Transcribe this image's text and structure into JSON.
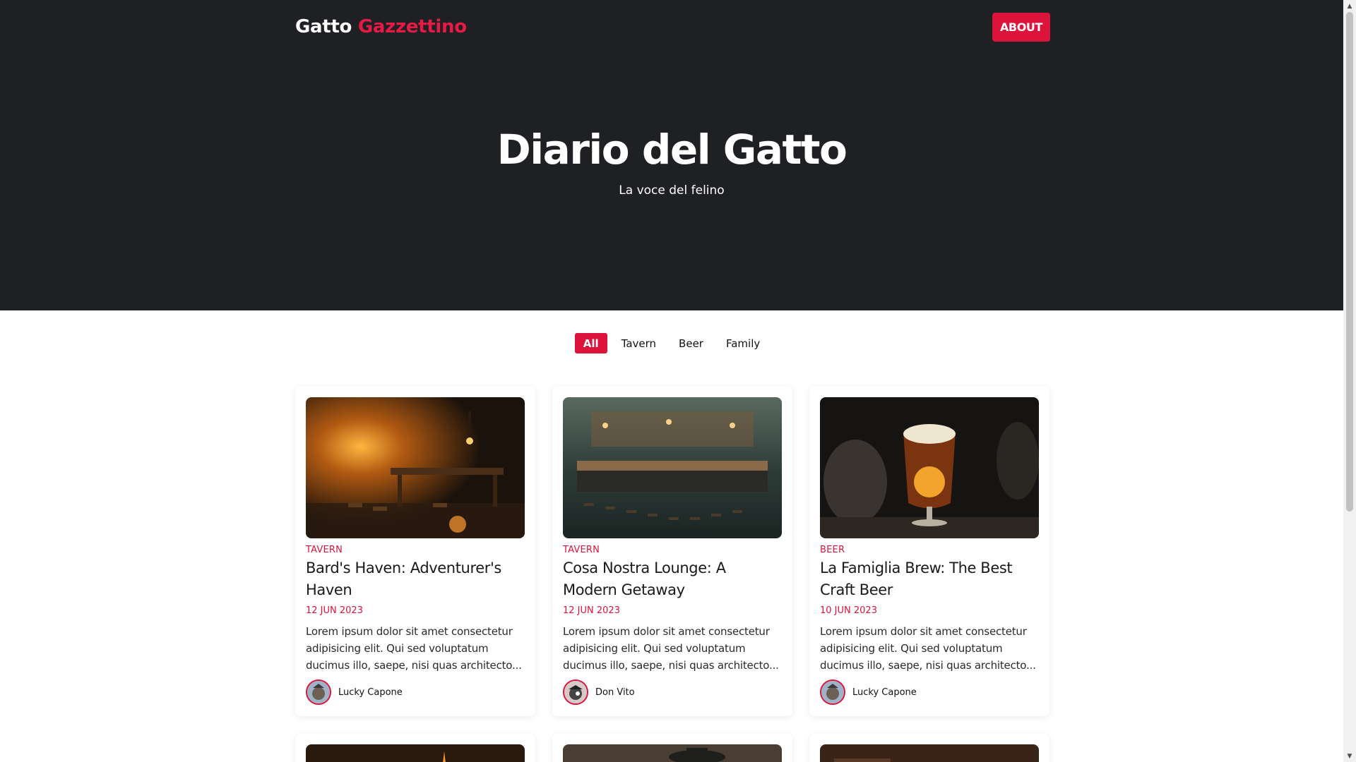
{
  "nav": {
    "logo_part1": "Gatto",
    "logo_part2": "Gazzettino",
    "about_label": "ABOUT"
  },
  "hero": {
    "title": "Diario del Gatto",
    "subtitle": "La voce del felino"
  },
  "filters": [
    {
      "label": "All",
      "active": true
    },
    {
      "label": "Tavern",
      "active": false
    },
    {
      "label": "Beer",
      "active": false
    },
    {
      "label": "Family",
      "active": false
    }
  ],
  "posts": [
    {
      "category": "TAVERN",
      "title": "Bard's Haven: Adventurer's Haven",
      "date": "12 JUN 2023",
      "excerpt": "Lorem ipsum dolor sit amet consectetur adipisicing elit. Qui sed voluptatum ducimus illo, saepe, nisi quas architecto...",
      "author": "Lucky Capone"
    },
    {
      "category": "TAVERN",
      "title": "Cosa Nostra Lounge: A Modern Getaway",
      "date": "12 JUN 2023",
      "excerpt": "Lorem ipsum dolor sit amet consectetur adipisicing elit. Qui sed voluptatum ducimus illo, saepe, nisi quas architecto...",
      "author": "Don Vito"
    },
    {
      "category": "BEER",
      "title": "La Famiglia Brew: The Best Craft Beer",
      "date": "10 JUN 2023",
      "excerpt": "Lorem ipsum dolor sit amet consectetur adipisicing elit. Qui sed voluptatum ducimus illo, saepe, nisi quas architecto...",
      "author": "Lucky Capone"
    }
  ],
  "colors": {
    "accent": "#dc143c",
    "hero_bg": "#1f2023"
  },
  "icons": {
    "scroll_up": "▲",
    "scroll_down": "▼"
  }
}
